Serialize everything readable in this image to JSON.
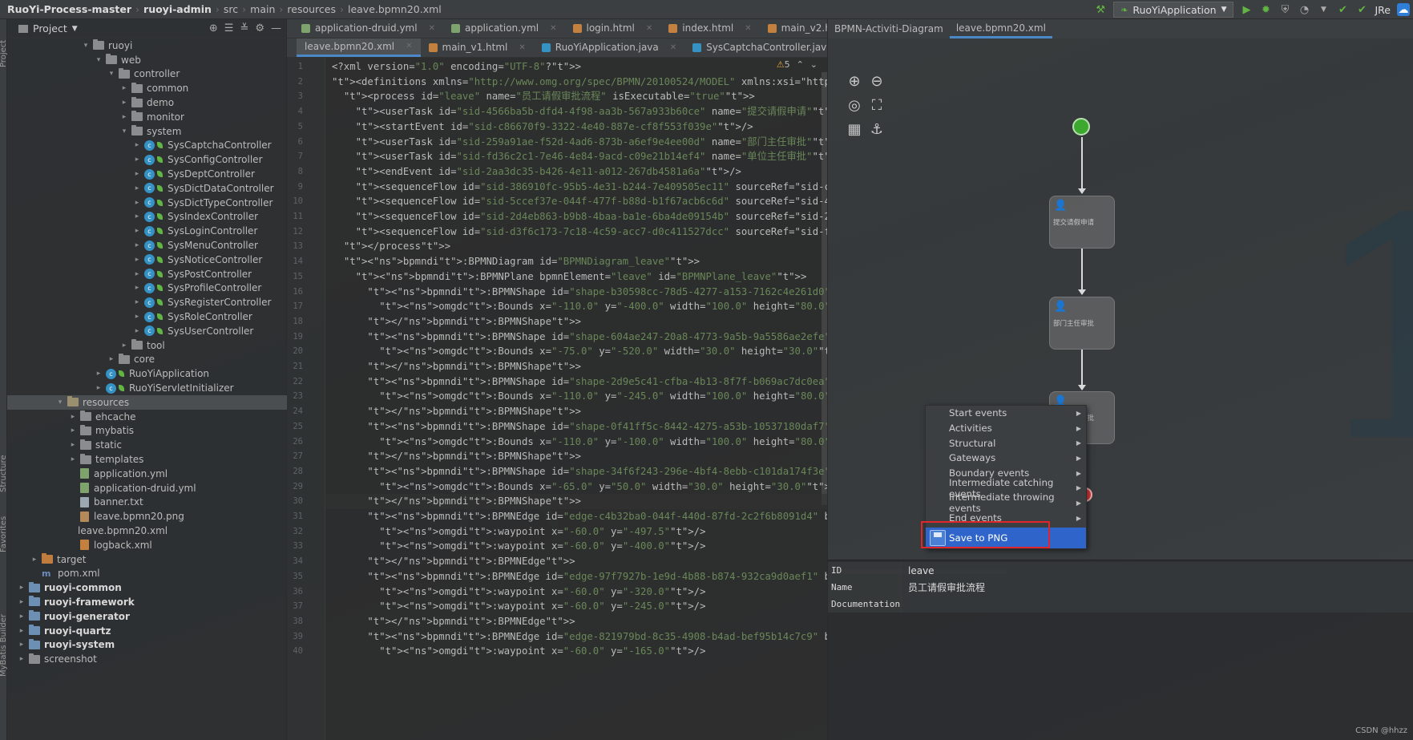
{
  "breadcrumb": [
    "RuoYi-Process-master",
    "ruoyi-admin",
    "src",
    "main",
    "resources",
    "leave.bpmn20.xml"
  ],
  "run_config": "RuoYiApplication",
  "toolbar_extra": "JRe",
  "project_panel": {
    "title": "Project"
  },
  "tree": [
    {
      "depth": 6,
      "arrow": "v",
      "icon": "folder",
      "label": "ruoyi"
    },
    {
      "depth": 7,
      "arrow": "v",
      "icon": "folder",
      "label": "web"
    },
    {
      "depth": 8,
      "arrow": "v",
      "icon": "folder",
      "label": "controller"
    },
    {
      "depth": 9,
      "arrow": ">",
      "icon": "folder",
      "label": "common"
    },
    {
      "depth": 9,
      "arrow": ">",
      "icon": "folder",
      "label": "demo"
    },
    {
      "depth": 9,
      "arrow": ">",
      "icon": "folder",
      "label": "monitor"
    },
    {
      "depth": 9,
      "arrow": "v",
      "icon": "folder",
      "label": "system"
    },
    {
      "depth": 10,
      "arrow": ">",
      "icon": "class",
      "label": "SysCaptchaController"
    },
    {
      "depth": 10,
      "arrow": ">",
      "icon": "class",
      "label": "SysConfigController"
    },
    {
      "depth": 10,
      "arrow": ">",
      "icon": "class",
      "label": "SysDeptController"
    },
    {
      "depth": 10,
      "arrow": ">",
      "icon": "class",
      "label": "SysDictDataController"
    },
    {
      "depth": 10,
      "arrow": ">",
      "icon": "class",
      "label": "SysDictTypeController"
    },
    {
      "depth": 10,
      "arrow": ">",
      "icon": "class",
      "label": "SysIndexController"
    },
    {
      "depth": 10,
      "arrow": ">",
      "icon": "class",
      "label": "SysLoginController"
    },
    {
      "depth": 10,
      "arrow": ">",
      "icon": "class",
      "label": "SysMenuController"
    },
    {
      "depth": 10,
      "arrow": ">",
      "icon": "class",
      "label": "SysNoticeController"
    },
    {
      "depth": 10,
      "arrow": ">",
      "icon": "class",
      "label": "SysPostController"
    },
    {
      "depth": 10,
      "arrow": ">",
      "icon": "class",
      "label": "SysProfileController"
    },
    {
      "depth": 10,
      "arrow": ">",
      "icon": "class",
      "label": "SysRegisterController"
    },
    {
      "depth": 10,
      "arrow": ">",
      "icon": "class",
      "label": "SysRoleController"
    },
    {
      "depth": 10,
      "arrow": ">",
      "icon": "class",
      "label": "SysUserController"
    },
    {
      "depth": 9,
      "arrow": ">",
      "icon": "folder",
      "label": "tool"
    },
    {
      "depth": 8,
      "arrow": ">",
      "icon": "folder",
      "label": "core"
    },
    {
      "depth": 7,
      "arrow": ">",
      "icon": "appclass",
      "label": "RuoYiApplication"
    },
    {
      "depth": 7,
      "arrow": ">",
      "icon": "class",
      "label": "RuoYiServletInitializer"
    },
    {
      "depth": 4,
      "arrow": "v",
      "icon": "resfolder",
      "label": "resources",
      "selected": true
    },
    {
      "depth": 5,
      "arrow": ">",
      "icon": "folder",
      "label": "ehcache"
    },
    {
      "depth": 5,
      "arrow": ">",
      "icon": "folder",
      "label": "mybatis"
    },
    {
      "depth": 5,
      "arrow": ">",
      "icon": "folder",
      "label": "static"
    },
    {
      "depth": 5,
      "arrow": ">",
      "icon": "folder",
      "label": "templates"
    },
    {
      "depth": 5,
      "arrow": "",
      "icon": "yml",
      "label": "application.yml"
    },
    {
      "depth": 5,
      "arrow": "",
      "icon": "yml",
      "label": "application-druid.yml"
    },
    {
      "depth": 5,
      "arrow": "",
      "icon": "file",
      "label": "banner.txt"
    },
    {
      "depth": 5,
      "arrow": "",
      "icon": "png",
      "label": "leave.bpmn20.png"
    },
    {
      "depth": 5,
      "arrow": "",
      "icon": "none",
      "label": "leave.bpmn20.xml"
    },
    {
      "depth": 5,
      "arrow": "",
      "icon": "xml",
      "label": "logback.xml"
    },
    {
      "depth": 2,
      "arrow": ">",
      "icon": "tgtfolder",
      "label": "target"
    },
    {
      "depth": 2,
      "arrow": "",
      "icon": "m",
      "label": "pom.xml"
    },
    {
      "depth": 1,
      "arrow": ">",
      "icon": "modfolder",
      "label": "ruoyi-common",
      "bold": true
    },
    {
      "depth": 1,
      "arrow": ">",
      "icon": "modfolder",
      "label": "ruoyi-framework",
      "bold": true
    },
    {
      "depth": 1,
      "arrow": ">",
      "icon": "modfolder",
      "label": "ruoyi-generator",
      "bold": true
    },
    {
      "depth": 1,
      "arrow": ">",
      "icon": "modfolder",
      "label": "ruoyi-quartz",
      "bold": true
    },
    {
      "depth": 1,
      "arrow": ">",
      "icon": "modfolder",
      "label": "ruoyi-system",
      "bold": true
    },
    {
      "depth": 1,
      "arrow": ">",
      "icon": "folder",
      "label": "screenshot"
    }
  ],
  "editor_tabs_row1": [
    {
      "label": "application-druid.yml",
      "color": "#7ea36c"
    },
    {
      "label": "application.yml",
      "color": "#7ea36c"
    },
    {
      "label": "login.html",
      "color": "#c4803f"
    },
    {
      "label": "index.html",
      "color": "#c4803f"
    },
    {
      "label": "main_v2.html",
      "color": "#c4803f"
    }
  ],
  "editor_tabs_row2": [
    {
      "label": "leave.bpmn20.xml",
      "color": "",
      "active": true
    },
    {
      "label": "main_v1.html",
      "color": "#c4803f"
    },
    {
      "label": "RuoYiApplication.java",
      "color": "#3592c4"
    },
    {
      "label": "SysCaptchaController.java",
      "color": "#3592c4"
    }
  ],
  "warnings": "5",
  "code_lines": [
    "<?xml version=\"1.0\" encoding=\"UTF-8\"?>",
    "<definitions xmlns=\"http://www.omg.org/spec/BPMN/20100524/MODEL\" xmlns:xsi=\"http://www.",
    "  <process id=\"leave\" name=\"员工请假审批流程\" isExecutable=\"true\">",
    "    <userTask id=\"sid-4566ba5b-dfd4-4f98-aa3b-567a933b60ce\" name=\"提交请假申请\"/>",
    "    <startEvent id=\"sid-c86670f9-3322-4e40-887e-cf8f553f039e\"/>",
    "    <userTask id=\"sid-259a91ae-f52d-4ad6-873b-a6ef9e4ee00d\" name=\"部门主任审批\"/>",
    "    <userTask id=\"sid-fd36c2c1-7e46-4e84-9acd-c09e21b14ef4\" name=\"单位主任审批\"/>",
    "    <endEvent id=\"sid-2aa3dc35-b426-4e11-a012-267db4581a6a\"/>",
    "    <sequenceFlow id=\"sid-386910fc-95b5-4e31-b244-7e409505ec11\" sourceRef=\"sid-c86670f9",
    "    <sequenceFlow id=\"sid-5ccef37e-044f-477f-b88d-b1f67acb6c6d\" sourceRef=\"sid-4566ba5b",
    "    <sequenceFlow id=\"sid-2d4eb863-b9b8-4baa-ba1e-6ba4de09154b\" sourceRef=\"sid-259a91ae",
    "    <sequenceFlow id=\"sid-d3f6c173-7c18-4c59-acc7-d0c411527dcc\" sourceRef=\"sid-fd36c2c1",
    "  </process>",
    "  <bpmndi:BPMNDiagram id=\"BPMNDiagram_leave\">",
    "    <bpmndi:BPMNPlane bpmnElement=\"leave\" id=\"BPMNPlane_leave\">",
    "      <bpmndi:BPMNShape id=\"shape-b30598cc-78d5-4277-a153-7162c4e261d0\" bpmnElement=\"si",
    "        <omgdc:Bounds x=\"-110.0\" y=\"-400.0\" width=\"100.0\" height=\"80.0\"/>",
    "      </bpmndi:BPMNShape>",
    "      <bpmndi:BPMNShape id=\"shape-604ae247-20a8-4773-9a5b-9a5586ae2efe\" bpmnElement=\"si",
    "        <omgdc:Bounds x=\"-75.0\" y=\"-520.0\" width=\"30.0\" height=\"30.0\"/>",
    "      </bpmndi:BPMNShape>",
    "      <bpmndi:BPMNShape id=\"shape-2d9e5c41-cfba-4b13-8f7f-b069ac7dc0ea\" bpmnElement=\"si",
    "        <omgdc:Bounds x=\"-110.0\" y=\"-245.0\" width=\"100.0\" height=\"80.0\"/>",
    "      </bpmndi:BPMNShape>",
    "      <bpmndi:BPMNShape id=\"shape-0f41ff5c-8442-4275-a53b-10537180daf7\" bpmnElement=\"si",
    "        <omgdc:Bounds x=\"-110.0\" y=\"-100.0\" width=\"100.0\" height=\"80.0\"/>",
    "      </bpmndi:BPMNShape>",
    "      <bpmndi:BPMNShape id=\"shape-34f6f243-296e-4bf4-8ebb-c101da174f3e\" bpmnElement=\"si",
    "        <omgdc:Bounds x=\"-65.0\" y=\"50.0\" width=\"30.0\" height=\"30.0\"/>",
    "      </bpmndi:BPMNShape>",
    "      <bpmndi:BPMNEdge id=\"edge-c4b32ba0-044f-440d-87fd-2c2f6b8091d4\" bpmnElement=\"sid-",
    "        <omgdi:waypoint x=\"-60.0\" y=\"-497.5\"/>",
    "        <omgdi:waypoint x=\"-60.0\" y=\"-400.0\"/>",
    "      </bpmndi:BPMNEdge>",
    "      <bpmndi:BPMNEdge id=\"edge-97f7927b-1e9d-4b88-b874-932ca9d0aef1\" bpmnElement=\"sid-",
    "        <omgdi:waypoint x=\"-60.0\" y=\"-320.0\"/>",
    "        <omgdi:waypoint x=\"-60.0\" y=\"-245.0\"/>",
    "      </bpmndi:BPMNEdge>",
    "      <bpmndi:BPMNEdge id=\"edge-821979bd-8c35-4908-b4ad-bef95b14c7c9\" bpmnElement=\"sid-",
    "        <omgdi:waypoint x=\"-60.0\" y=\"-165.0\"/>"
  ],
  "current_line": 30,
  "right_tabs": [
    "BPMN-Activiti-Diagram",
    "leave.bpmn20.xml"
  ],
  "diagram": {
    "tasks": [
      "提交请假申请",
      "部门主任审批",
      "单位主任审批"
    ]
  },
  "context_menu": {
    "items": [
      "Start events",
      "Activities",
      "Structural",
      "Gateways",
      "Boundary events",
      "Intermediate catching events",
      "Intermediate throwing events",
      "End events"
    ],
    "save_label": "Save to PNG"
  },
  "properties": [
    {
      "key": "ID",
      "value": "leave"
    },
    {
      "key": "Name",
      "value": "员工请假审批流程"
    },
    {
      "key": "Documentation",
      "value": ""
    }
  ],
  "credit": "CSDN @hhzz",
  "side_labels": [
    "Project",
    "Structure",
    "Favorites",
    "MyBatis Builder"
  ]
}
